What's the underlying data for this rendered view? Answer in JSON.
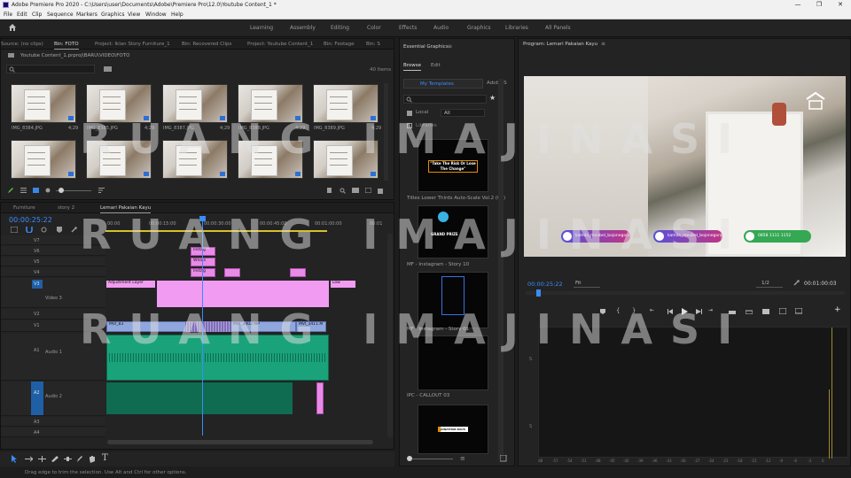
{
  "window": {
    "title": "Adobe Premiere Pro 2020 - C:\\Users\\user\\Documents\\Adobe\\Premiere Pro\\12.0\\Youtube Content_1 *",
    "controls": [
      "—",
      "❐",
      "✕"
    ]
  },
  "menu": [
    "File",
    "Edit",
    "Clip",
    "Sequence",
    "Markers",
    "Graphics",
    "View",
    "Window",
    "Help"
  ],
  "workspaces": [
    "Learning",
    "Assembly",
    "Editing",
    "Color",
    "Effects",
    "Audio",
    "Graphics",
    "Libraries",
    "All Panels"
  ],
  "project": {
    "tabs": [
      "Source: (no clips)",
      "Bin: FOTO",
      "Project: Iklan Story Furniture_1",
      "Bin: Recovered Clips",
      "Project: Youtube Content_1",
      "Bin: Footage",
      "Bin: S"
    ],
    "path": "Youtube Content_1.prproj\\BARU\\VIDEO\\FOTO",
    "item_count": "40 Items",
    "row1": [
      {
        "name": "IMG_8384.JPG",
        "dur": "4;29"
      },
      {
        "name": "IMG_8385.JPG",
        "dur": "4;29"
      },
      {
        "name": "IMG_8387.JPG",
        "dur": "4;29"
      },
      {
        "name": "IMG_8388.JPG",
        "dur": "4;29"
      },
      {
        "name": "IMG_8389.JPG",
        "dur": "4;29"
      }
    ]
  },
  "timeline": {
    "tabs": [
      "Furniture",
      "story 2",
      "Lemari Pakaian Kayu"
    ],
    "timecode": "00:00:25:22",
    "ruler": [
      "00:00",
      "00:00:15:00",
      "00:00:30:00",
      "00:00:45:00",
      "00:01:00:00",
      "00:01"
    ],
    "video_tracks": [
      "V7",
      "V6",
      "V5",
      "V4",
      "V3",
      "V2",
      "V1"
    ],
    "audio_tracks": [
      "A1",
      "A2",
      "A3",
      "A4"
    ],
    "video3_label": "Video 3",
    "audio1_label": "Audio 1",
    "audio2_label": "Audio 2",
    "clips": {
      "v7": "Instag",
      "v6": "Whats",
      "v5": "Instag",
      "adj": "Adjustment Layer",
      "low": "Low",
      "v1a": "MVI_83",
      "v1b": "MVI_3402.MP",
      "v1c": "MVI_3411.M"
    }
  },
  "essential": {
    "title": "Essential Graphics",
    "tabs": [
      "Browse",
      "Edit"
    ],
    "dropdown": "My Templates",
    "adobe": "Adobe S",
    "local": "Local",
    "all": "All",
    "libraries": "Libraries",
    "items": [
      {
        "caption": "Titles Lower Thirds Auto-Scale Vol.2 (06)",
        "art": "\"Take The Risk Or Lose The Change\""
      },
      {
        "caption": "MF - Instagram - Story 10",
        "art": "GRAND PRIZE"
      },
      {
        "caption": "MF - Instagram - Story 01",
        "art": ""
      },
      {
        "caption": "IPC - CALLOUT 03",
        "art": ""
      },
      {
        "caption": "",
        "art": "JONATHAN KAUS"
      }
    ]
  },
  "program": {
    "title": "Program: Lemari Pakaian Kayu",
    "timecode": "00:00:25:22",
    "fit": "Fit",
    "ratio": "1/2",
    "duration": "00:01:00:03",
    "socials": [
      {
        "label": "kamila_meubel_bojonegoro",
        "color": "#c13584"
      },
      {
        "label": "kamila_meubel_bojonegoro",
        "color": "#c13584"
      },
      {
        "label": "0858 1111 1152",
        "color": "#25d366"
      }
    ],
    "meter_db": [
      "dB",
      "-57",
      "-54",
      "-51",
      "-48",
      "-45",
      "-42",
      "-39",
      "-36",
      "-33",
      "-30",
      "-27",
      "-24",
      "-21",
      "-18",
      "-15",
      "-12",
      "-9",
      "-6",
      "-3",
      "0"
    ],
    "meter_s": "S"
  },
  "watermark": "RUANG IMAJINASI",
  "status": "Drag edge to trim the selection. Use Alt and Ctrl for other options."
}
